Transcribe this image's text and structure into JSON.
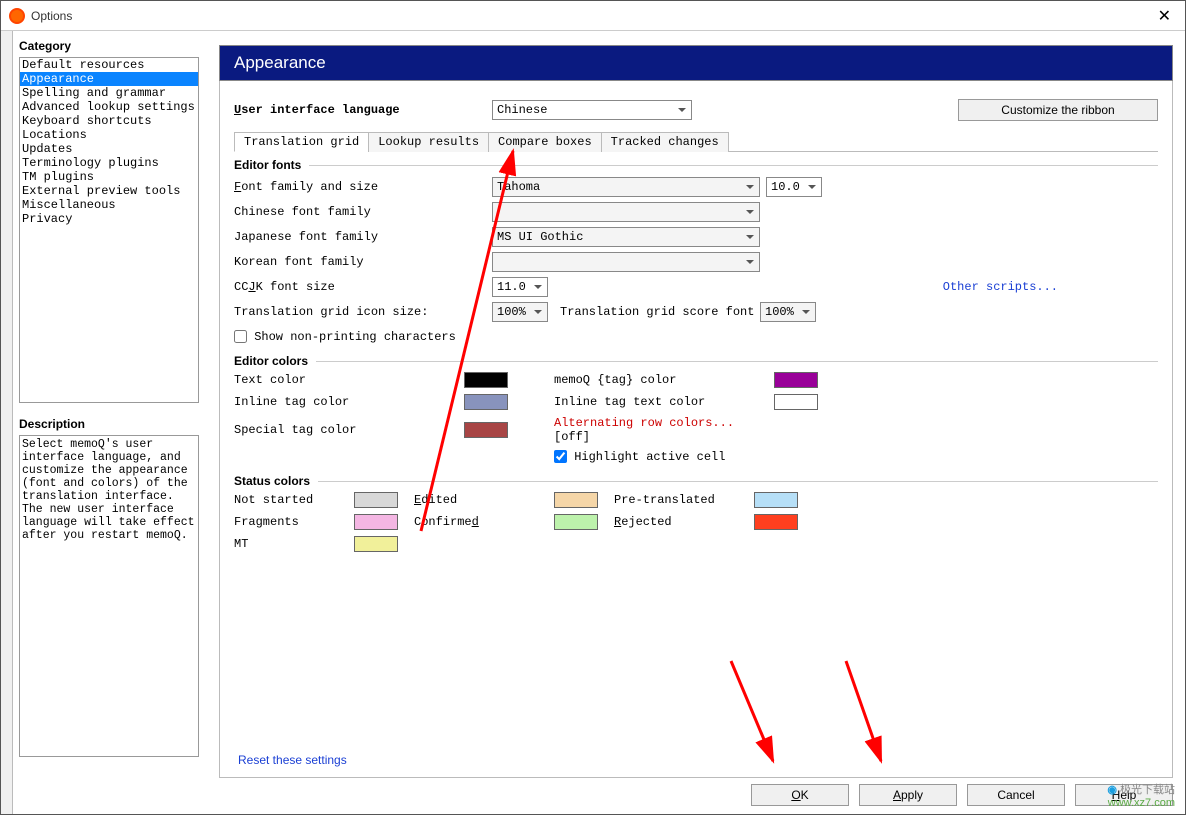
{
  "window": {
    "title": "Options"
  },
  "sidebar": {
    "category_label": "Category",
    "items": [
      "Default resources",
      "Appearance",
      "Spelling and grammar",
      "Advanced lookup settings",
      "Keyboard shortcuts",
      "Locations",
      "Updates",
      "Terminology plugins",
      "TM plugins",
      "External preview tools",
      "Miscellaneous",
      "Privacy"
    ],
    "selected_index": 1,
    "description_label": "Description",
    "description_text": "Select memoQ's user interface language, and customize the appearance (font and colors) of the translation interface. The new user interface language will take effect after you restart memoQ."
  },
  "main": {
    "header": "Appearance",
    "ui_lang_label": "User interface language",
    "ui_lang_value": "Chinese",
    "customize_btn": "Customize the ribbon",
    "tabs": [
      "Translation grid",
      "Lookup results",
      "Compare boxes",
      "Tracked changes"
    ],
    "active_tab": 0,
    "sections": {
      "editor_fonts": {
        "title": "Editor fonts",
        "font_family_label": "Font family and size",
        "font_family_value": "Tahoma",
        "font_size_value": "10.0",
        "chinese_label": "Chinese font family",
        "japanese_label": "Japanese font family",
        "japanese_value": "MS UI Gothic",
        "korean_label": "Korean font family",
        "ccjk_label": "CCJK font size",
        "ccjk_value": "11.0",
        "other_scripts": "Other scripts...",
        "icon_size_label": "Translation grid icon size:",
        "icon_size_value": "100%",
        "score_font_label": "Translation grid score font",
        "score_font_value": "100%",
        "show_nonprinting": "Show non-printing characters"
      },
      "editor_colors": {
        "title": "Editor colors",
        "text_color": "Text color",
        "text_color_val": "#000000",
        "memoq_tag": "memoQ {tag} color",
        "memoq_tag_val": "#990099",
        "inline_tag": "Inline tag color",
        "inline_tag_val": "#8893bd",
        "inline_text": "Inline tag text color",
        "inline_text_val": "#ffffff",
        "special_tag": "Special tag color",
        "special_tag_val": "#a84545",
        "alt_row": "Alternating row colors...",
        "alt_row_state": "[off]",
        "highlight": "Highlight active cell"
      },
      "status_colors": {
        "title": "Status colors",
        "not_started": "Not started",
        "not_started_c": "#d8d8d8",
        "edited": "Edited",
        "edited_c": "#f5d6a8",
        "pretranslated": "Pre-translated",
        "pretranslated_c": "#b6dff7",
        "fragments": "Fragments",
        "fragments_c": "#f4b6e3",
        "confirmed": "Confirmed",
        "confirmed_c": "#bdf2ac",
        "rejected": "Rejected",
        "rejected_c": "#ff3f1f",
        "mt": "MT",
        "mt_c": "#f1f09a"
      }
    },
    "reset": "Reset these settings"
  },
  "footer": {
    "ok": "OK",
    "apply": "Apply",
    "cancel": "Cancel",
    "help": "Help"
  },
  "watermark": {
    "line1": "极光下载站",
    "line2": "www.xz7.com"
  }
}
